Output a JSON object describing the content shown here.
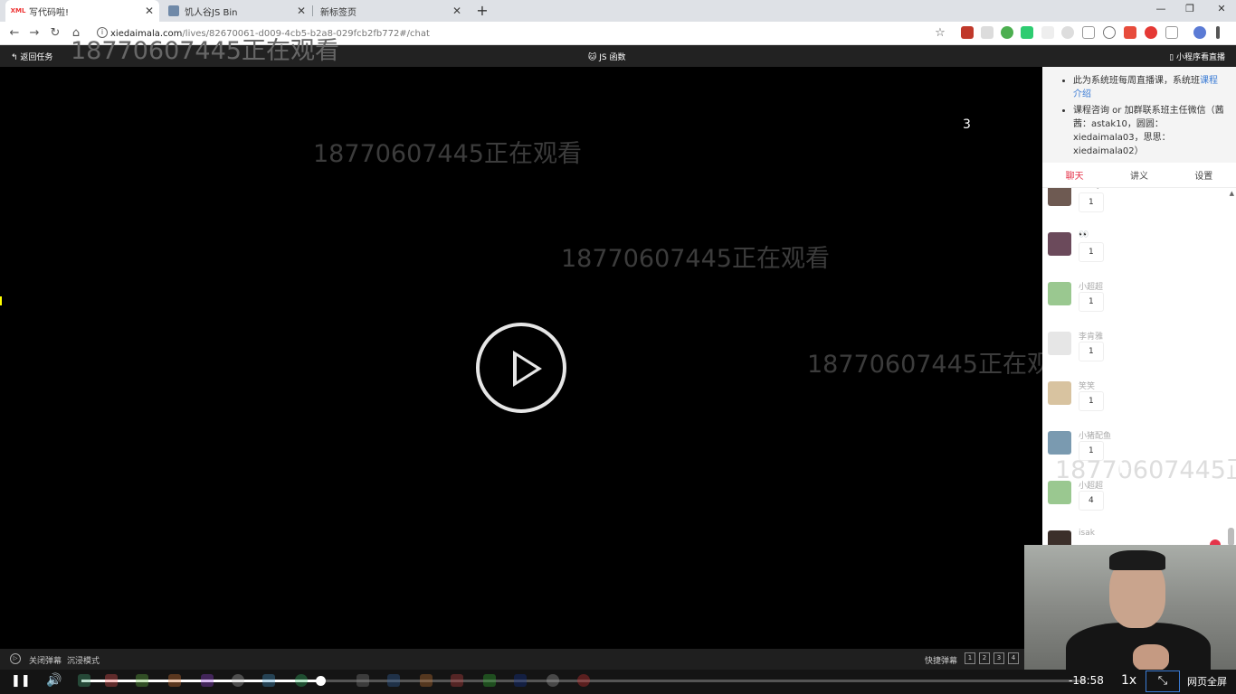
{
  "tabs": [
    {
      "title": "写代码啦!",
      "favicon": "xdml"
    },
    {
      "title": "饥人谷JS Bin",
      "favicon": ""
    },
    {
      "title": "新标签页",
      "favicon": ""
    }
  ],
  "address": {
    "host": "xiedaimala.com",
    "path": "/lives/82670061-d009-4cb5-b2a8-029fcb2fb772#/chat"
  },
  "page_header": {
    "back_label": "返回任务",
    "title": "JS 函数",
    "mini_label": "小程序看直播"
  },
  "video": {
    "watermark": "18770607445正在观看",
    "count": "3"
  },
  "notice": {
    "item1_text": "此为系统班每周直播课，系统班",
    "item1_link": "课程介绍",
    "item2_text": "课程咨询 or 加群联系班主任微信（茜茜：astak10，圆圆：xiedaimala03，思思：xiedaimala02）"
  },
  "sidebar_tabs": [
    "聊天",
    "讲义",
    "设置"
  ],
  "chat": [
    {
      "name": "See you soon",
      "text": "1",
      "avatar_color": "#6e5a52"
    },
    {
      "name": "👀",
      "text": "1",
      "avatar_color": "#6b4a5b"
    },
    {
      "name": "小超超",
      "text": "1",
      "avatar_color": "#9ac890"
    },
    {
      "name": "李肯雅",
      "text": "1",
      "avatar_color": "#e6e6e6"
    },
    {
      "name": "笑笑",
      "text": "1",
      "avatar_color": "#d8c3a0"
    },
    {
      "name": "小猪配鱼",
      "text": "1",
      "avatar_color": "#7a9ab0"
    },
    {
      "name": "小超超",
      "text": "4",
      "avatar_color": "#9ac890"
    },
    {
      "name": "isak",
      "text": "",
      "avatar_color": "#3b2f2a"
    }
  ],
  "danmaku_bar": {
    "close_label": "关闭弹幕",
    "immersive_label": "沉浸模式",
    "quick_label": "快捷弹幕",
    "quick_nums": [
      "1",
      "2",
      "3",
      "4"
    ]
  },
  "controls": {
    "time": "-18:58",
    "speed": "1x",
    "web_fullscreen_label": "网页全屏",
    "progress": 0.238
  },
  "icons": [
    "play-icon",
    "pause-icon",
    "volume-icon",
    "exit-fullscreen-icon",
    "back-arrow-icon",
    "star-icon"
  ]
}
